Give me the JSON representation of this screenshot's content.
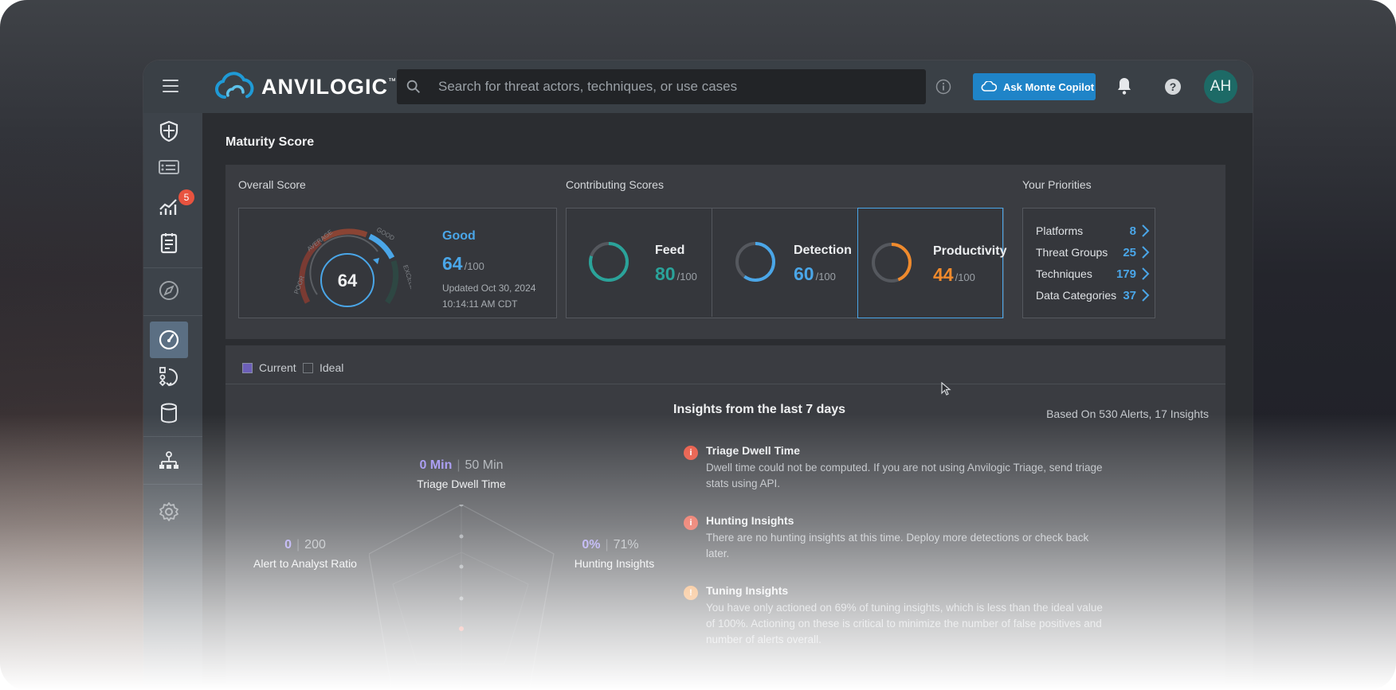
{
  "app": {
    "brand": "ANVILOGIC",
    "trademark": "™",
    "search_placeholder": "Search for threat actors, techniques, or use cases",
    "copilot_button": "Ask Monte Copilot",
    "avatar_initials": "AH"
  },
  "sidebar": {
    "items": [
      {
        "icon": "shield-icon"
      },
      {
        "icon": "detections-list-icon"
      },
      {
        "icon": "trend-chart-icon",
        "badge": "5"
      },
      {
        "icon": "notebook-icon"
      },
      {
        "icon": "compass-icon"
      },
      {
        "icon": "gauge-icon",
        "active": true
      },
      {
        "icon": "workflow-icon"
      },
      {
        "icon": "database-icon"
      },
      {
        "icon": "hierarchy-icon"
      },
      {
        "icon": "settings-icon"
      }
    ]
  },
  "main": {
    "page_title": "Maturity Score",
    "overall": {
      "label": "Overall Score",
      "score": "64",
      "rating": "Good",
      "value": "64",
      "out_of": "/100",
      "updated_line1": "Updated Oct 30, 2024",
      "updated_line2": "10:14:11 AM CDT",
      "gauge_labels": {
        "poor": "POOR",
        "average": "AVERAGE",
        "good": "GOOD",
        "excellent": "EXCELLENT"
      },
      "gauge_fraction": 0.64
    },
    "contributing": {
      "label": "Contributing Scores",
      "items": [
        {
          "name": "Feed",
          "value": "80",
          "out_of": "/100",
          "fraction": 0.8,
          "color": "#2aa39a"
        },
        {
          "name": "Detection",
          "value": "60",
          "out_of": "/100",
          "fraction": 0.6,
          "color": "#4aa6e8"
        },
        {
          "name": "Productivity",
          "value": "44",
          "out_of": "/100",
          "fraction": 0.44,
          "color": "#f08a2c"
        }
      ]
    },
    "priorities": {
      "label": "Your Priorities",
      "items": [
        {
          "name": "Platforms",
          "count": "8"
        },
        {
          "name": "Threat Groups",
          "count": "25"
        },
        {
          "name": "Techniques",
          "count": "179"
        },
        {
          "name": "Data Categories",
          "count": "37"
        }
      ]
    },
    "legend": {
      "current": "Current",
      "ideal": "Ideal"
    },
    "radar": {
      "axes": [
        {
          "name": "Triage Dwell Time",
          "current": "0 Min",
          "ideal": "50 Min"
        },
        {
          "name": "Alert to Analyst Ratio",
          "current": "0",
          "ideal": "200"
        },
        {
          "name": "Hunting Insights",
          "current": "0%",
          "ideal": "71%"
        }
      ]
    },
    "insights": {
      "title": "Insights from the last 7 days",
      "based_on": "Based On 530 Alerts, 17 Insights",
      "items": [
        {
          "title": "Triage Dwell Time",
          "desc": "Dwell time could not be computed. If you are not using Anvilogic Triage, send triage stats using API.",
          "color": "#e8533f"
        },
        {
          "title": "Hunting Insights",
          "desc": "There are no hunting insights at this time. Deploy more detections or check back later.",
          "color": "#e8533f"
        },
        {
          "title": "Tuning Insights",
          "desc": "You have only actioned on 69% of tuning insights, which is less than the ideal value of 100%. Actioning on these is critical to minimize the number of false positives and number of alerts overall.",
          "color": "#f08a2c"
        }
      ]
    }
  }
}
